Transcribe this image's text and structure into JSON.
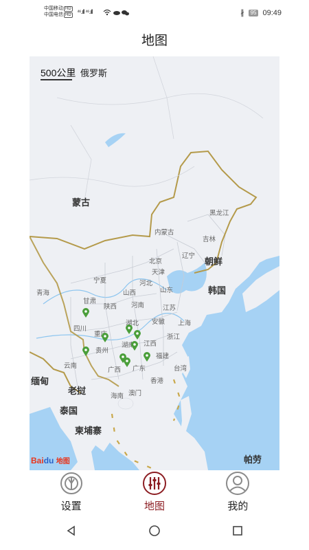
{
  "status": {
    "carrier1": "中国移动",
    "carrier2": "中国电信",
    "hd": "HD",
    "signal": "⁴⁶.ıll ⁴⁶.ıll",
    "battery": "95",
    "time": "09:49"
  },
  "header": {
    "title": "地图"
  },
  "map": {
    "scale": "500公里",
    "countries": [
      "俄罗斯",
      "蒙古",
      "朝鲜",
      "韩国",
      "缅甸",
      "老挝",
      "泰国",
      "柬埔寨",
      "帕劳"
    ],
    "provinces": [
      "黑龙江",
      "吉林",
      "辽宁",
      "内蒙古",
      "北京",
      "天津",
      "河北",
      "山西",
      "山东",
      "宁夏",
      "甘肃",
      "青海",
      "陕西",
      "河南",
      "江苏",
      "安徽",
      "上海",
      "湖北",
      "四川",
      "重庆",
      "浙江",
      "湖南",
      "江西",
      "贵州",
      "云南",
      "广西",
      "广东",
      "福建",
      "台湾",
      "香港",
      "澳门",
      "海南"
    ],
    "marker_icon": "location-pin-icon",
    "accent": "#4a9e3a",
    "border_color": "#b49a4a",
    "water_color": "#a6d2f4"
  },
  "watermark": {
    "bai": "Bai",
    "du": "du",
    "cn": "地图"
  },
  "tabs": [
    {
      "label": "设置",
      "icon": "settings-icon"
    },
    {
      "label": "地图",
      "icon": "map-equalizer-icon"
    },
    {
      "label": "我的",
      "icon": "user-icon"
    }
  ],
  "sysnav": {
    "back_icon": "back-triangle-icon",
    "home_icon": "home-circle-icon",
    "recents_icon": "recents-square-icon"
  }
}
